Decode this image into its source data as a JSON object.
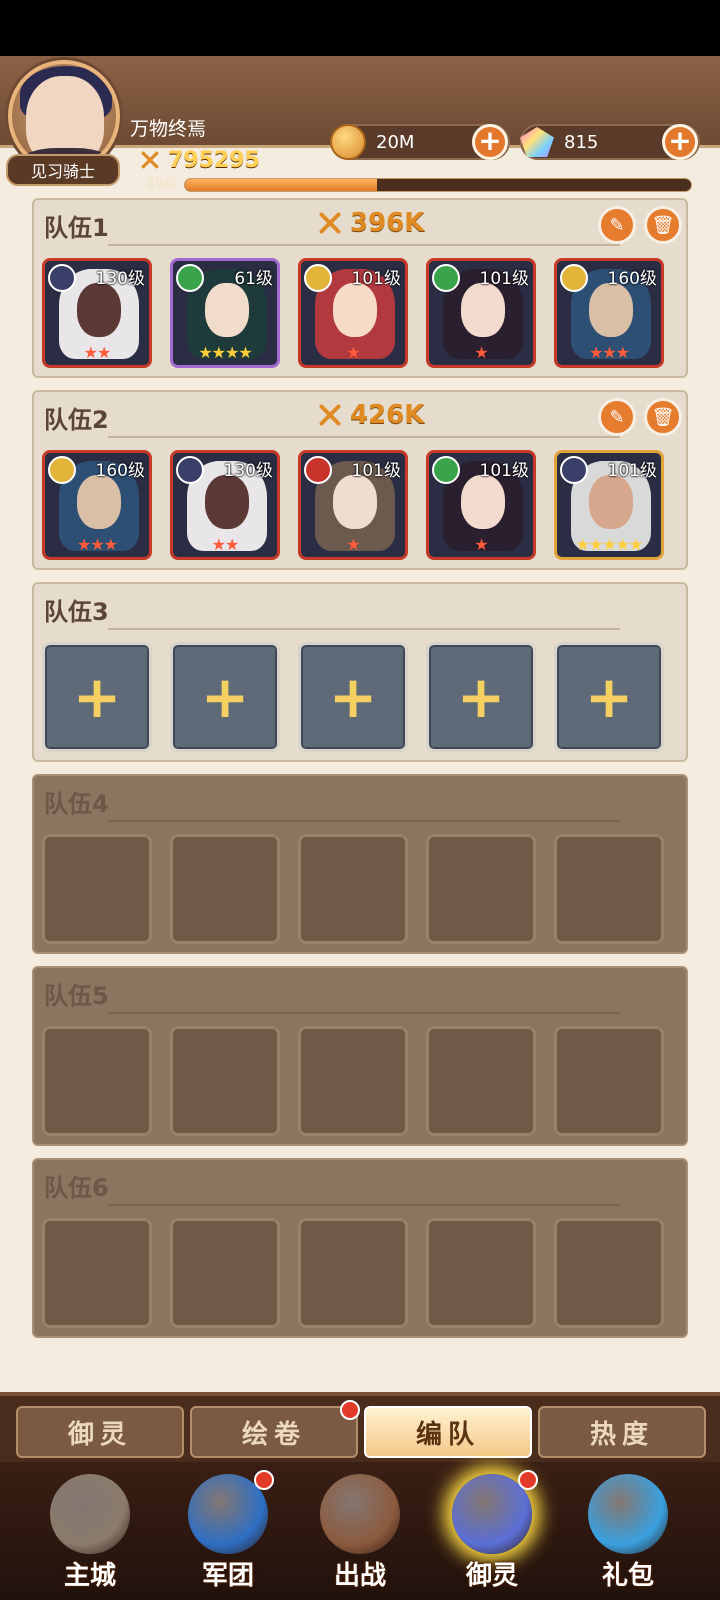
{
  "header": {
    "player_name": "万物终焉",
    "power": "795295",
    "rank_title": "见习骑士",
    "level": "49级",
    "xp_fraction": 0.38,
    "gold": "20M",
    "gems": "815"
  },
  "teams": [
    {
      "title": "队伍1",
      "power": "396K",
      "heroes": [
        {
          "level": "130级",
          "stars": "★★",
          "star_color": "red",
          "frame": "red",
          "faction_color": "#3a3f6a",
          "hair": "#e9e6ea",
          "skin": "#5b3a36"
        },
        {
          "level": "61级",
          "stars": "★★★★",
          "star_color": "gold",
          "frame": "purple",
          "faction_color": "#3ba34a",
          "hair": "#1f3a3a",
          "skin": "#f1dccb"
        },
        {
          "level": "101级",
          "stars": "★",
          "star_color": "red",
          "frame": "red",
          "faction_color": "#e3b43a",
          "hair": "#b23a3f",
          "skin": "#f6dcc8"
        },
        {
          "level": "101级",
          "stars": "★",
          "star_color": "red",
          "frame": "red",
          "faction_color": "#3ba34a",
          "hair": "#2a1f2e",
          "skin": "#f2dace"
        },
        {
          "level": "160级",
          "stars": "★★★",
          "star_color": "red",
          "frame": "red",
          "faction_color": "#e3b43a",
          "hair": "#2e4f74",
          "skin": "#d9bfa6"
        }
      ]
    },
    {
      "title": "队伍2",
      "power": "426K",
      "heroes": [
        {
          "level": "160级",
          "stars": "★★★",
          "star_color": "red",
          "frame": "red",
          "faction_color": "#e3b43a",
          "hair": "#2e4f74",
          "skin": "#d9bfa6"
        },
        {
          "level": "130级",
          "stars": "★★",
          "star_color": "red",
          "frame": "red",
          "faction_color": "#3a3f6a",
          "hair": "#e9e6ea",
          "skin": "#5b3a36"
        },
        {
          "level": "101级",
          "stars": "★",
          "star_color": "red",
          "frame": "red",
          "faction_color": "#c8332b",
          "hair": "#6d5a4e",
          "skin": "#f0dcd0"
        },
        {
          "level": "101级",
          "stars": "★",
          "star_color": "red",
          "frame": "red",
          "faction_color": "#3ba34a",
          "hair": "#2a1f2e",
          "skin": "#f2dace"
        },
        {
          "level": "101级",
          "stars": "★★★★★",
          "star_color": "gold",
          "frame": "gold",
          "faction_color": "#3a3f6a",
          "hair": "#d9d9d9",
          "skin": "#d6a78c"
        }
      ]
    },
    {
      "title": "队伍3",
      "state": "open",
      "slots": [
        "+",
        "+",
        "+",
        "+",
        "+"
      ]
    },
    {
      "title": "队伍4",
      "state": "locked"
    },
    {
      "title": "队伍5",
      "state": "locked"
    },
    {
      "title": "队伍6",
      "state": "locked"
    }
  ],
  "subtabs": [
    {
      "label": "御灵",
      "active": false
    },
    {
      "label": "绘卷",
      "active": false,
      "badge": true
    },
    {
      "label": "编队",
      "active": true
    },
    {
      "label": "热度",
      "active": false
    }
  ],
  "nav": [
    {
      "label": "主城",
      "icon": "castle-statue-icon",
      "color": "#8a7b6c"
    },
    {
      "label": "军团",
      "icon": "legion-fist-icon",
      "color": "#2e6fc4",
      "badge": true
    },
    {
      "label": "出战",
      "icon": "battle-gate-icon",
      "color": "#8c5b3e"
    },
    {
      "label": "御灵",
      "icon": "spirit-crystal-icon",
      "color": "#5b6fd6",
      "active": true,
      "badge": true
    },
    {
      "label": "礼包",
      "icon": "gift-shop-icon",
      "color": "#3aa0e0"
    }
  ]
}
